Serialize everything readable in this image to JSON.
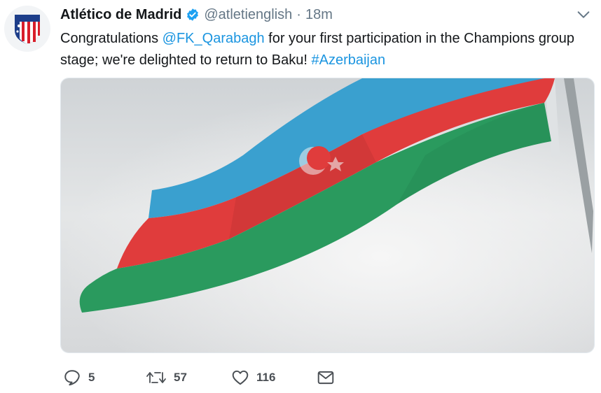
{
  "tweet": {
    "author_name": "Atlético de Madrid",
    "handle": "@atletienglish",
    "separator": "·",
    "timestamp": "18m",
    "text_part1": "Congratulations ",
    "mention": "@FK_Qarabagh",
    "text_part2": "  for your first participation in the Champions group stage; we're delighted to return to Baku! ",
    "hashtag": "#Azerbaijan"
  },
  "media": {
    "description_icon": "azerbaijan-flag",
    "flag_colors": {
      "blue": "#3aa0cf",
      "red": "#e03c3c",
      "green": "#2a9a5e"
    }
  },
  "actions": {
    "reply_count": "5",
    "retweet_count": "57",
    "like_count": "116"
  },
  "colors": {
    "link": "#1b95e0",
    "verified": "#1da1f2",
    "secondary_text": "#657786"
  }
}
